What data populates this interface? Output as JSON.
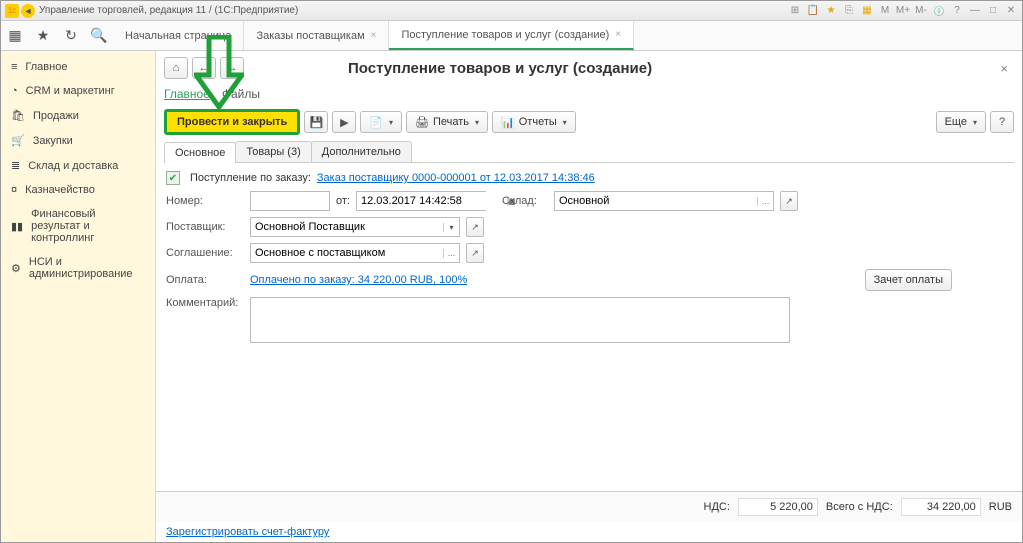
{
  "titlebar": {
    "text": "Управление торговлей, редакция 11 / (1С:Предприятие)"
  },
  "tabs": {
    "t1": "Начальная страница",
    "t2": "Заказы поставщикам",
    "t3": "Поступление товаров и услуг (создание)"
  },
  "sidebar": {
    "main": "Главное",
    "crm": "CRM и маркетинг",
    "sales": "Продажи",
    "purch": "Закупки",
    "stock": "Склад и доставка",
    "fin": "Казначейство",
    "res": "Финансовый результат и контроллинг",
    "nsi": "НСИ и администрирование"
  },
  "page": {
    "title": "Поступление товаров и услуг (создание)",
    "subnav": {
      "main": "Главное",
      "files": "Файлы"
    },
    "toolbar": {
      "post_close": "Провести и закрыть",
      "print": "Печать",
      "reports": "Отчеты",
      "more": "Еще"
    },
    "inner_tabs": {
      "main": "Основное",
      "goods": "Товары (3)",
      "extra": "Дополнительно"
    },
    "form": {
      "by_order_label": "Поступление по заказу:",
      "by_order_link": "Заказ поставщику 0000-000001 от 12.03.2017 14:38:46",
      "number_label": "Номер:",
      "from_label": "от:",
      "date_value": "12.03.2017 14:42:58",
      "stock_label": "Склад:",
      "stock_value": "Основной",
      "supplier_label": "Поставщик:",
      "supplier_value": "Основной Поставщик",
      "agreement_label": "Соглашение:",
      "agreement_value": "Основное с поставщиком",
      "payment_label": "Оплата:",
      "payment_link": "Оплачено по заказу: 34 220,00 RUB, 100%",
      "offset_btn": "Зачет оплаты",
      "comment_label": "Комментарий:"
    },
    "footer": {
      "nds_label": "НДС:",
      "nds_value": "5 220,00",
      "total_label": "Всего с НДС:",
      "total_value": "34 220,00",
      "currency": "RUB"
    },
    "register_link": "Зарегистрировать счет-фактуру"
  },
  "chart_data": null
}
